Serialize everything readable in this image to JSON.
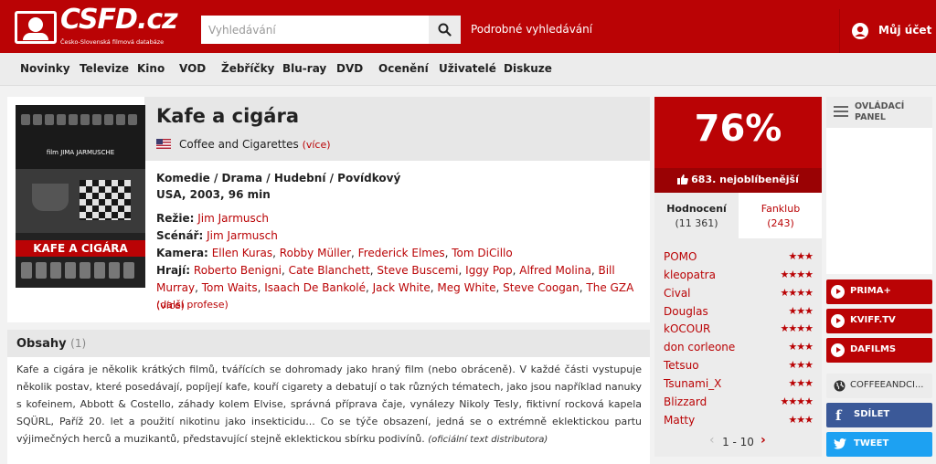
{
  "header": {
    "logo_text": "CSFD.cz",
    "logo_subtitle": "Česko-Slovenská filmová databáze",
    "search_placeholder": "Vyhledávání",
    "advanced_search": "Podrobné vyhledávání",
    "account": "Můj účet",
    "color": "#ba0305"
  },
  "nav": [
    "Novinky",
    "Televize",
    "Kino",
    "VOD",
    "Žebříčky",
    "Blu-ray",
    "DVD",
    "Ocenění",
    "Uživatelé",
    "Diskuze"
  ],
  "film": {
    "title": "Kafe a cigára",
    "original_title": "Coffee and Cigarettes",
    "original_more": "(více)",
    "genres": "Komedie / Drama / Hudební / Povídkový",
    "origin": "USA, 2003, 96 min",
    "poster": {
      "director_line": "film JIMA JARMUSCHE",
      "title": "KAFE A CIGÁRA"
    },
    "credits": {
      "directing_label": "Režie:",
      "directing": "Jim Jarmusch",
      "screenplay_label": "Scénář:",
      "screenplay": "Jim Jarmusch",
      "camera_label": "Kamera:",
      "camera": [
        "Ellen Kuras",
        "Robby Müller",
        "Frederick Elmes",
        "Tom DiCillo"
      ],
      "cast_label": "Hrají:",
      "cast": [
        "Roberto Benigni",
        "Cate Blanchett",
        "Steve Buscemi",
        "Iggy Pop",
        "Alfred Molina",
        "Bill Murray",
        "Tom Waits",
        "Isaach De Bankolé",
        "Jack White",
        "Meg White",
        "Steve Coogan",
        "The GZA"
      ],
      "cast_more": "(více)",
      "more_professions": "(další profese)"
    }
  },
  "plot": {
    "heading": "Obsahy",
    "count": "(1)",
    "text": "Kafe a cigára je několik krátkých filmů, tvářících se dohromady jako hraný film (nebo obráceně). V každé části vystupuje několik postav, které posedávají, popíjejí kafe, kouří cigarety a debatují o tak různých tématech, jako jsou například nanuky s kofeinem, Abbott & Costello, záhady kolem Elvise, správná příprava čaje, vynálezy Nikoly Tesly, fiktivní rocková kapela SQÜRL, Paříž 20. let a použití nikotinu jako insekticidu... Co se týče obsazení, jedná se o extrémně eklektickou partu výjimečných herců a muzikantů, představující stejně eklektickou sbírku podivínů.",
    "source": "(oficiální text distributora)"
  },
  "rating": {
    "value": "76%",
    "rank": "683. nejoblíbenější",
    "tabs": [
      {
        "label": "Hodnocení",
        "count": "(11 361)"
      },
      {
        "label": "Fanklub",
        "count": "(243)"
      }
    ],
    "users": [
      {
        "name": "POMO",
        "stars": "★★★"
      },
      {
        "name": "kleopatra",
        "stars": "★★★★"
      },
      {
        "name": "Cival",
        "stars": "★★★★"
      },
      {
        "name": "Douglas",
        "stars": "★★★"
      },
      {
        "name": "kOCOUR",
        "stars": "★★★★"
      },
      {
        "name": "don corleone",
        "stars": "★★★"
      },
      {
        "name": "Tetsuo",
        "stars": "★★★"
      },
      {
        "name": "Tsunami_X",
        "stars": "★★★"
      },
      {
        "name": "Blizzard",
        "stars": "★★★★"
      },
      {
        "name": "Matty",
        "stars": "★★★"
      }
    ],
    "pager": "1 - 10"
  },
  "sidebar": {
    "control_panel": "OVLÁDACÍ PANEL",
    "vod": [
      "PRIMA+",
      "KVIFF.TV",
      "DAFILMS"
    ],
    "website": "COFFEEANDCI...",
    "share": "SDÍLET",
    "tweet": "TWEET"
  }
}
